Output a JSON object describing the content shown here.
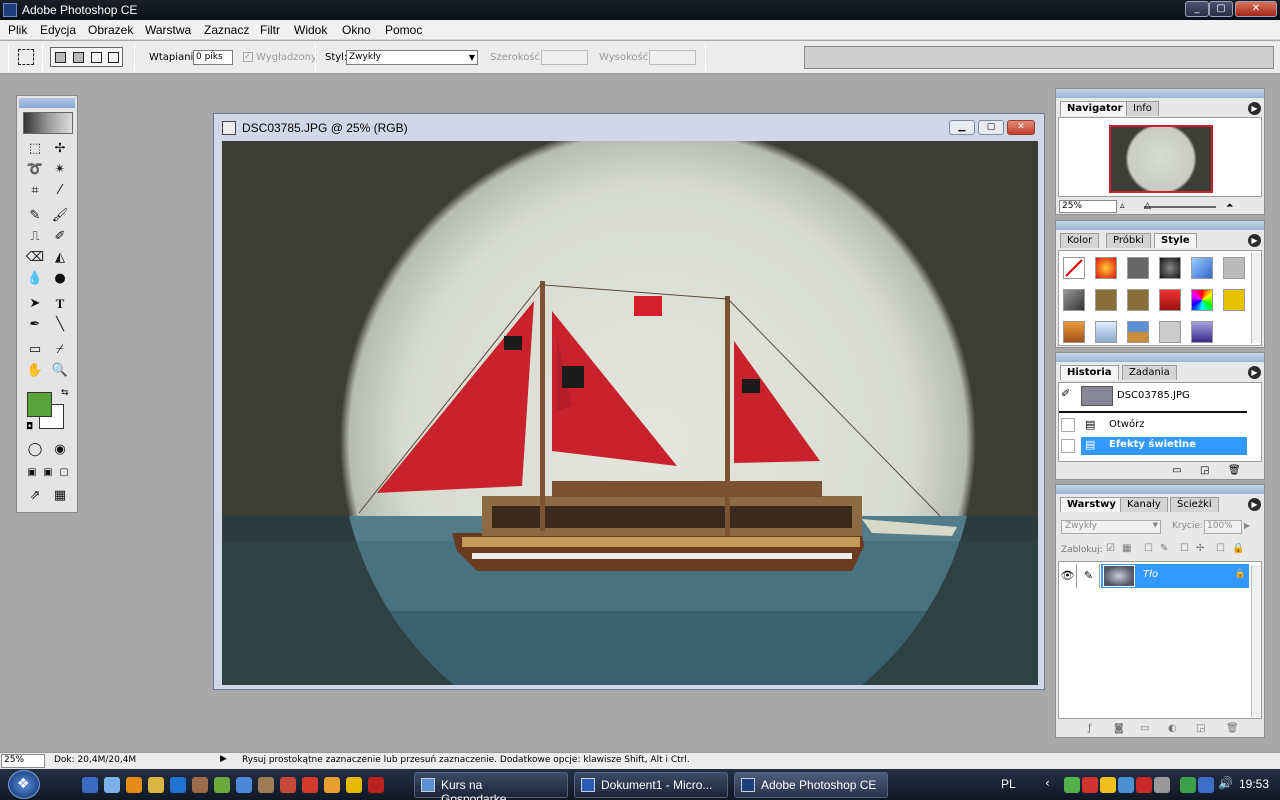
{
  "app": {
    "title": "Adobe Photoshop CE"
  },
  "menu": [
    "Plik",
    "Edycja",
    "Obrazek",
    "Warstwa",
    "Zaznacz",
    "Filtr",
    "Widok",
    "Okno",
    "Pomoc"
  ],
  "options": {
    "feather_label": "Wtapianie",
    "feather_value": "0 piks",
    "antialias_label": "Wygładzony",
    "style_label": "Styl:",
    "style_value": "Zwykły",
    "width_label": "Szerokość:",
    "height_label": "Wysokość:"
  },
  "document": {
    "title": "DSC03785.JPG @ 25% (RGB)"
  },
  "navigator": {
    "tabs": [
      "Navigator",
      "Info"
    ],
    "zoom": "25%"
  },
  "color_panel": {
    "tabs": [
      "Kolor",
      "Próbki",
      "Style"
    ]
  },
  "history": {
    "tabs": [
      "Historia",
      "Zadania"
    ],
    "snapshot": "DSC03785.JPG",
    "items": [
      "Otwórz",
      "Efekty świetlne"
    ]
  },
  "layers": {
    "tabs": [
      "Warstwy",
      "Kanały",
      "Ścieżki"
    ],
    "blend_mode": "Zwykły",
    "opacity_label": "Krycie:",
    "opacity_value": "100%",
    "lock_label": "Zablokuj:",
    "layer_name": "Tło"
  },
  "status": {
    "zoom": "25%",
    "doc": "Dok: 20,4M/20,4M",
    "hint": "Rysuj prostokątne zaznaczenie lub przesuń zaznaczenie.  Dodatkowe opcje: klawisze Shift, Alt i Ctrl."
  },
  "taskbar": {
    "tasks": [
      "Kurs na Gospodarkę...",
      "Dokument1 - Micro...",
      "Adobe Photoshop CE"
    ],
    "lang": "PL",
    "clock": "19:53"
  },
  "colors": {
    "foreground": "#5aa23a",
    "background": "#ffffff",
    "sail": "#c9222c",
    "selection": "#3399ff"
  }
}
